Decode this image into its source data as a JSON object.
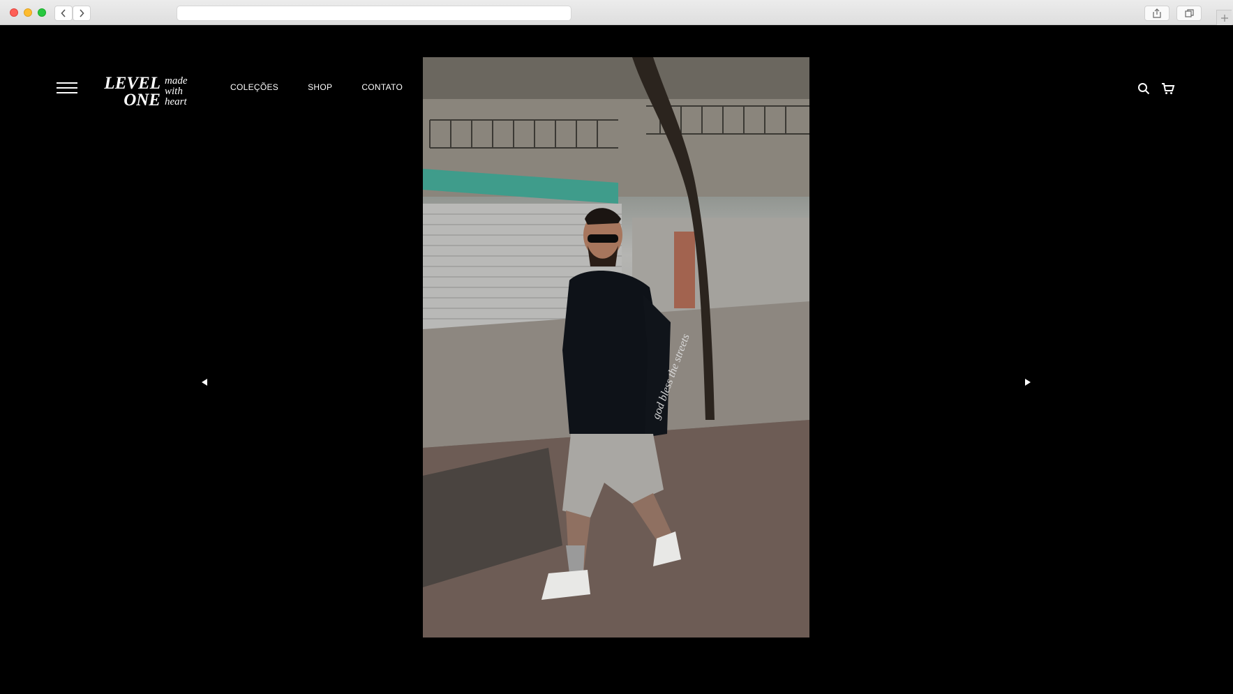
{
  "browser": {
    "address_value": "",
    "icons": {
      "back": "chevron-left-icon",
      "forward": "chevron-right-icon",
      "share": "share-icon",
      "tabs": "tabs-overview-icon",
      "new_tab": "plus-icon"
    }
  },
  "header": {
    "menu_icon": "hamburger-menu-icon",
    "logo": {
      "line1": "LEVEL",
      "line2": "ONE",
      "tagline1": "made",
      "tagline2": "with",
      "tagline3": "heart"
    },
    "nav": [
      {
        "label": "COLEÇÕES"
      },
      {
        "label": "SHOP"
      },
      {
        "label": "CONTATO"
      }
    ],
    "icons": {
      "search": "search-icon",
      "cart": "cart-icon"
    }
  },
  "hero": {
    "image_subject": "model-photo",
    "prev_icon": "arrow-left-icon",
    "next_icon": "arrow-right-icon"
  },
  "colors": {
    "background": "#000000",
    "text": "#ffffff",
    "chrome": "#e6e6e6"
  }
}
